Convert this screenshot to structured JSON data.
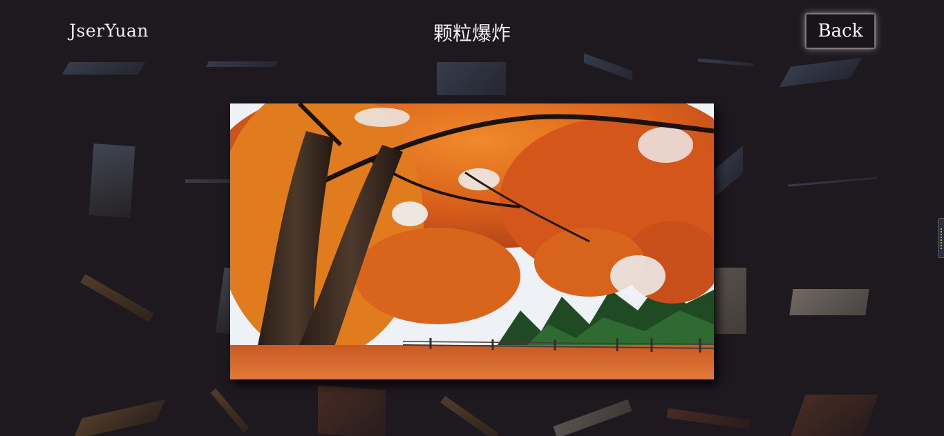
{
  "header": {
    "brand": "JserYuan",
    "title": "颗粒爆炸",
    "back_label": "Back"
  },
  "image": {
    "subject": "autumn maple trees",
    "accent": "#e8731c"
  },
  "colors": {
    "background": "#1e191f",
    "text": "#f2f2f2"
  }
}
